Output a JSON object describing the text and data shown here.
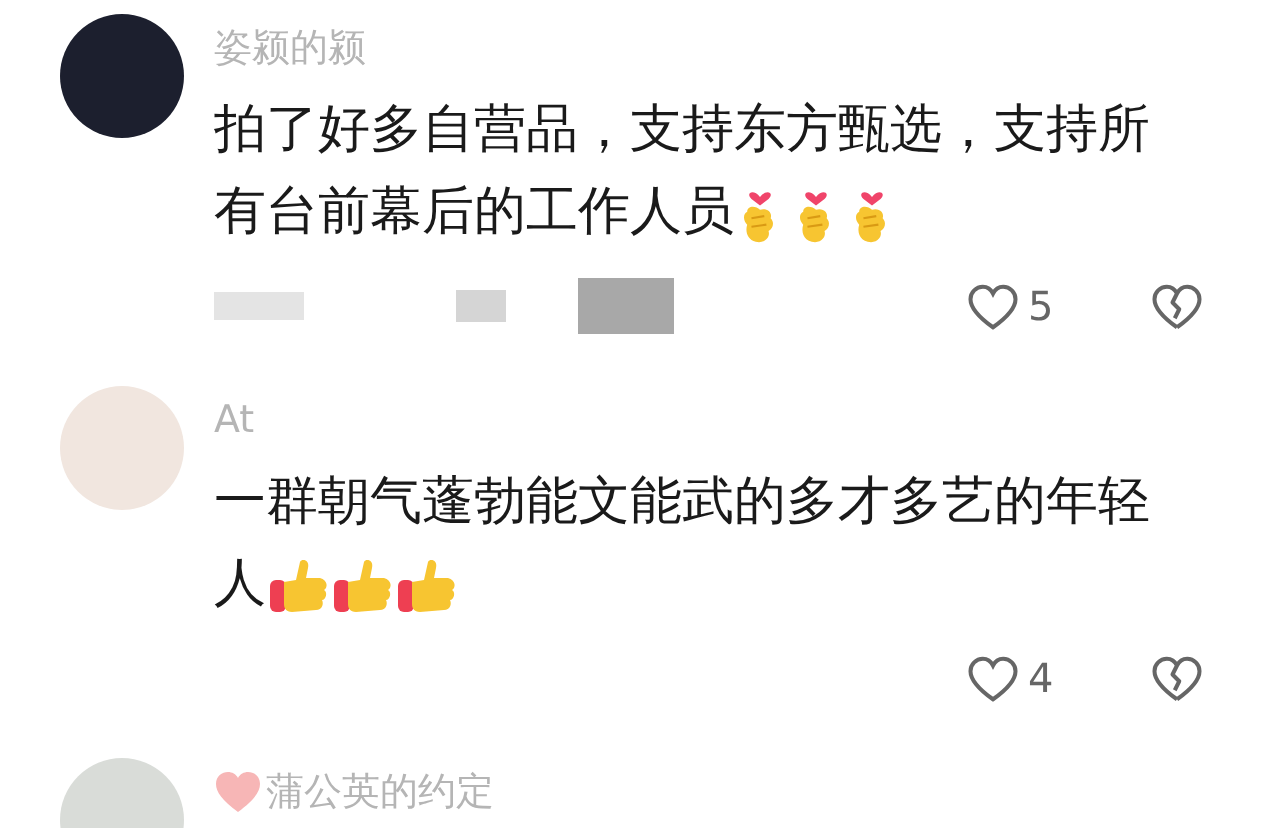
{
  "comments": [
    {
      "username": "姿颍的颍",
      "name_heart": false,
      "lines": [
        "拍了好多自营品，支持东方甄选，支持所",
        "有台前幕后的工作人员"
      ],
      "emojis": [
        {
          "kind": "finger-heart"
        },
        {
          "kind": "finger-heart"
        },
        {
          "kind": "finger-heart"
        }
      ],
      "redacted": true,
      "likes": "5"
    },
    {
      "username": "At",
      "name_heart": false,
      "lines": [
        "一群朝气蓬勃能文能武的多才多艺的年轻",
        "人"
      ],
      "emojis": [
        {
          "kind": "thumbs-up"
        },
        {
          "kind": "thumbs-up"
        },
        {
          "kind": "thumbs-up"
        }
      ],
      "redacted": false,
      "likes": "4"
    },
    {
      "username": "蒲公英的约定",
      "name_heart": true
    }
  ]
}
